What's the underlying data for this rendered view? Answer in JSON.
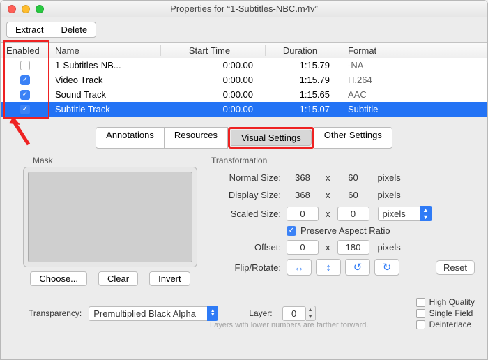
{
  "window_title": "Properties for “1-Subtitles-NBC.m4v”",
  "toolbar": {
    "extract": "Extract",
    "delete": "Delete"
  },
  "table": {
    "headers": {
      "enabled": "Enabled",
      "name": "Name",
      "start": "Start Time",
      "duration": "Duration",
      "format": "Format"
    },
    "rows": [
      {
        "enabled": false,
        "name": "1-Subtitles-NB...",
        "start": "0:00.00",
        "duration": "1:15.79",
        "format": "-NA-"
      },
      {
        "enabled": true,
        "name": "Video Track",
        "start": "0:00.00",
        "duration": "1:15.79",
        "format": "H.264"
      },
      {
        "enabled": true,
        "name": "Sound Track",
        "start": "0:00.00",
        "duration": "1:15.65",
        "format": "AAC"
      },
      {
        "enabled": true,
        "name": "Subtitle Track",
        "start": "0:00.00",
        "duration": "1:15.07",
        "format": "Subtitle",
        "selected": true
      }
    ]
  },
  "tabs": {
    "annotations": "Annotations",
    "resources": "Resources",
    "visual": "Visual Settings",
    "other": "Other Settings"
  },
  "mask": {
    "label": "Mask",
    "choose": "Choose...",
    "clear": "Clear",
    "invert": "Invert"
  },
  "trans": {
    "label": "Transformation",
    "normal": "Normal Size:",
    "normal_w": "368",
    "normal_h": "60",
    "display": "Display Size:",
    "display_w": "368",
    "display_h": "60",
    "scaled": "Scaled Size:",
    "scaled_w": "0",
    "scaled_h": "0",
    "unit": "pixels",
    "preserve": "Preserve Aspect Ratio",
    "offset": "Offset:",
    "offset_x": "0",
    "offset_y": "180",
    "flip": "Flip/Rotate:",
    "reset": "Reset"
  },
  "bottom": {
    "transparency_label": "Transparency:",
    "transparency_value": "Premultiplied Black Alpha",
    "layer_label": "Layer:",
    "layer_value": "0",
    "hint": "Layers with lower numbers are farther forward.",
    "hq": "High Quality",
    "sf": "Single Field",
    "di": "Deinterlace"
  }
}
